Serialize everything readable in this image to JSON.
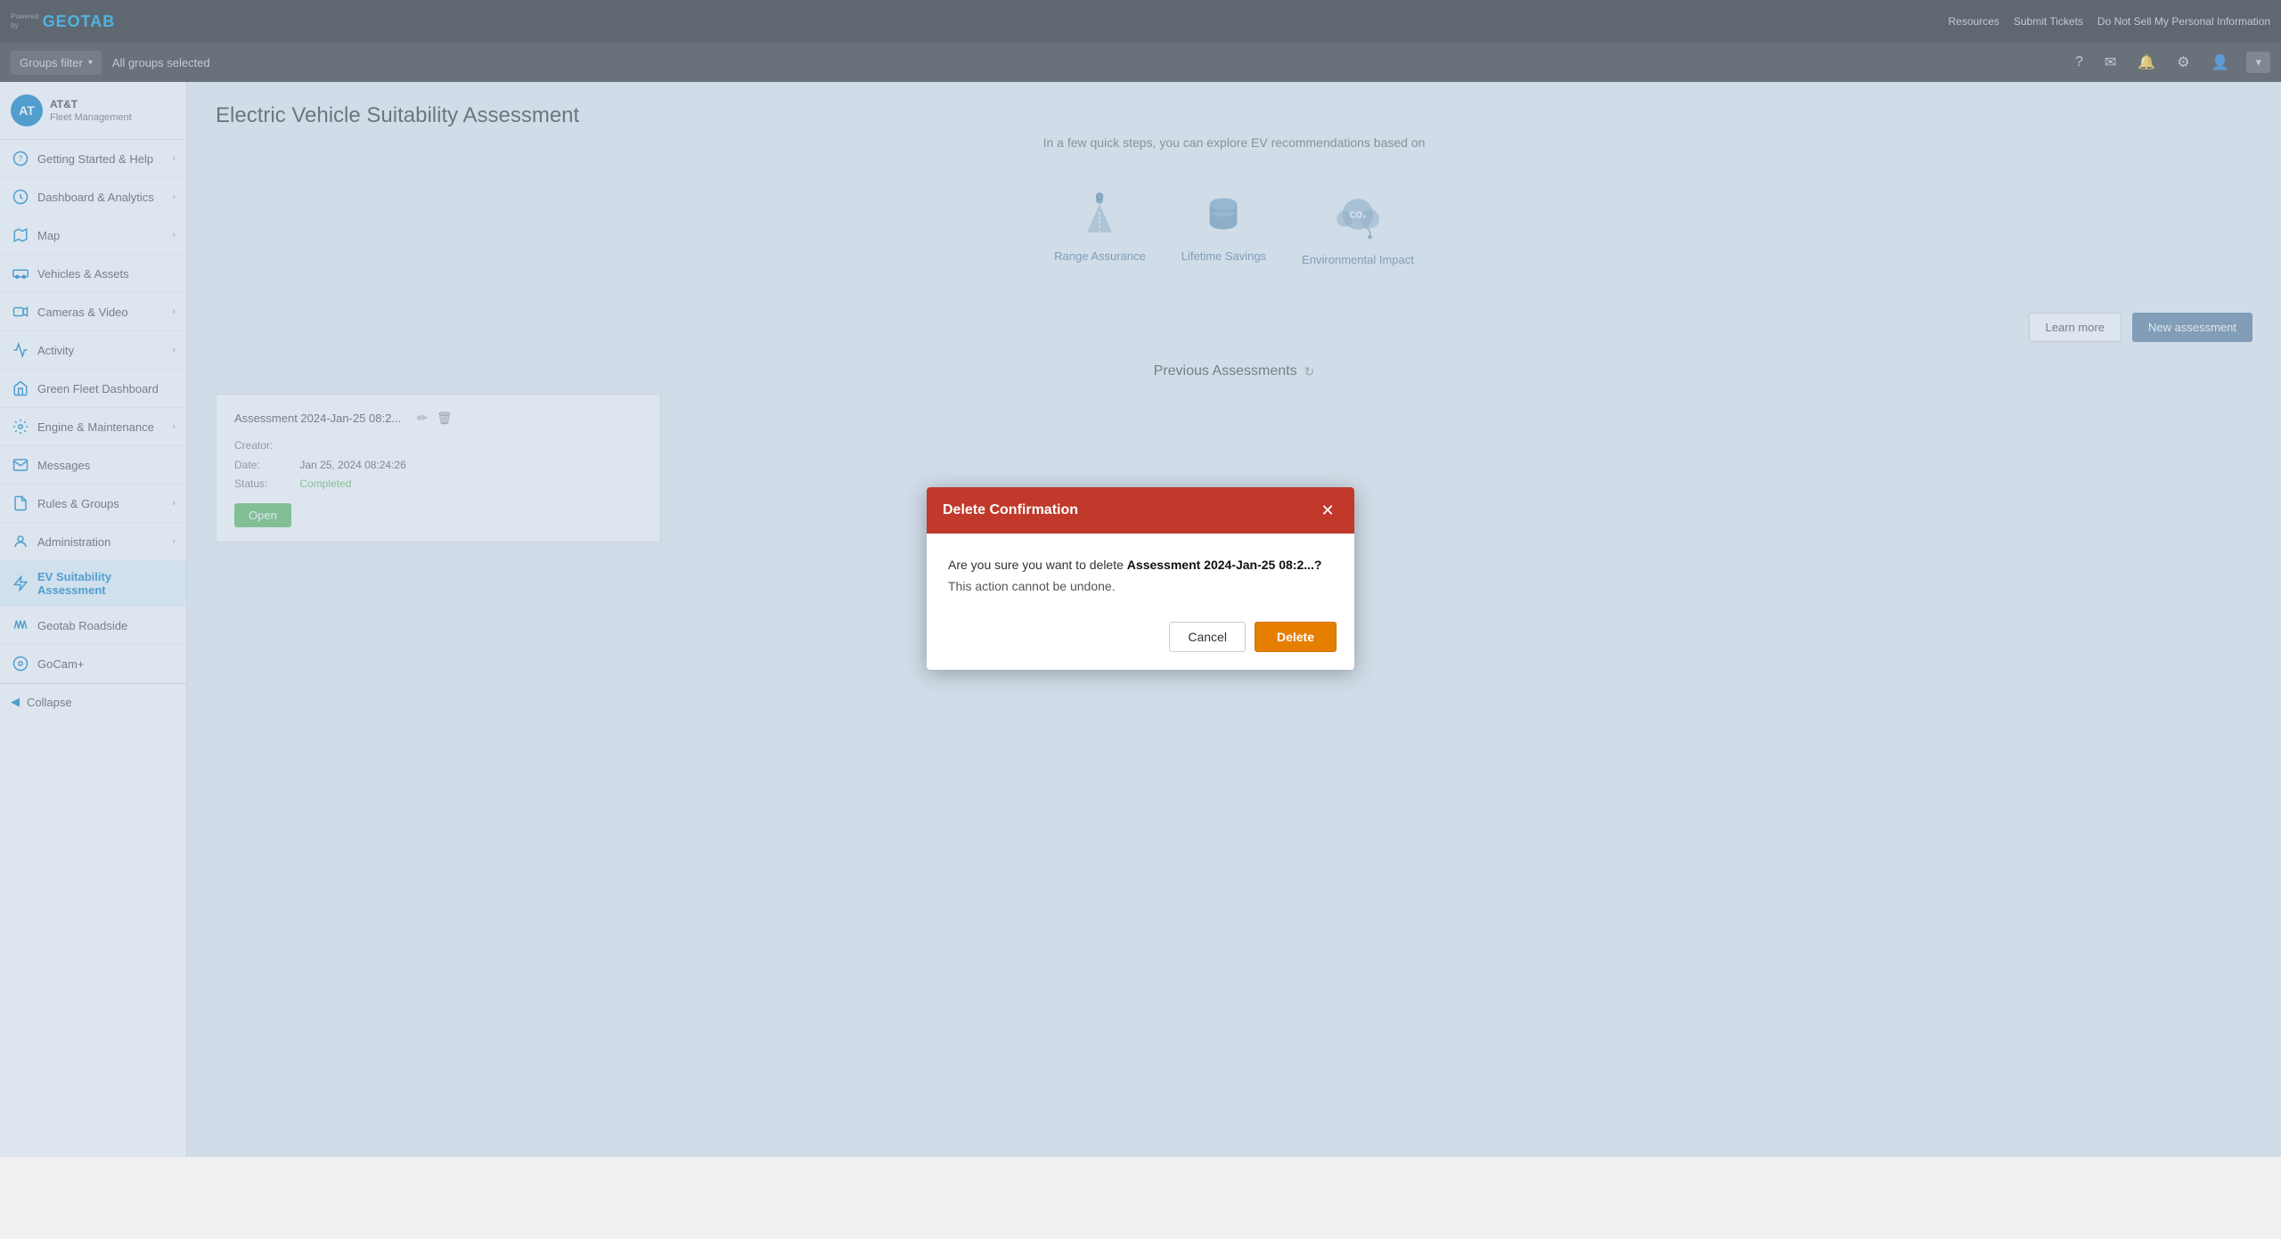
{
  "topbar": {
    "logo_powered": "Powered",
    "logo_by": "by",
    "logo_brand": "GEOTAB",
    "links": [
      "Resources",
      "Submit Tickets",
      "Do Not Sell My Personal Information"
    ]
  },
  "filterbar": {
    "groups_filter_label": "Groups filter",
    "groups_selected_label": "All groups selected",
    "chevron": "▾"
  },
  "sidebar": {
    "brand_name": "AT&T",
    "brand_sub": "Fleet Management",
    "items": [
      {
        "id": "getting-started",
        "label": "Getting Started & Help",
        "icon": "?"
      },
      {
        "id": "dashboard",
        "label": "Dashboard & Analytics",
        "icon": "📊"
      },
      {
        "id": "map",
        "label": "Map",
        "icon": "🗺"
      },
      {
        "id": "vehicles",
        "label": "Vehicles & Assets",
        "icon": "🚛"
      },
      {
        "id": "cameras",
        "label": "Cameras & Video",
        "icon": "📷"
      },
      {
        "id": "activity",
        "label": "Activity",
        "icon": "📈"
      },
      {
        "id": "green-fleet",
        "label": "Green Fleet Dashboard",
        "icon": "🌿"
      },
      {
        "id": "engine",
        "label": "Engine & Maintenance",
        "icon": "🔧"
      },
      {
        "id": "messages",
        "label": "Messages",
        "icon": "✉"
      },
      {
        "id": "rules",
        "label": "Rules & Groups",
        "icon": "📋"
      },
      {
        "id": "admin",
        "label": "Administration",
        "icon": "⚙"
      },
      {
        "id": "ev-assessment",
        "label": "EV Suitability Assessment",
        "icon": "⚡",
        "active": true
      },
      {
        "id": "roadside",
        "label": "Geotab Roadside",
        "icon": "🛣"
      },
      {
        "id": "gocam",
        "label": "GoCam+",
        "icon": "📹"
      }
    ],
    "collapse_label": "Collapse"
  },
  "main": {
    "title": "Electric Vehicle Suitability Assessment",
    "subtitle": "In a few quick steps, you can explore EV recommendations based on",
    "features": [
      {
        "id": "range",
        "label": "Range Assurance"
      },
      {
        "id": "savings",
        "label": "Lifetime Savings"
      },
      {
        "id": "impact",
        "label": "Environmental Impact"
      }
    ],
    "btn_learn_more": "Learn more",
    "btn_new_assessment": "New assessment",
    "previous_assessments_label": "Previous Assessments",
    "assessment": {
      "name": "Assessment 2024-Jan-25 08:2...",
      "creator_label": "Creator:",
      "creator_value": "",
      "date_label": "Date:",
      "date_value": "Jan 25, 2024 08:24:26",
      "status_label": "Status:",
      "status_value": "Completed",
      "btn_open": "Open"
    }
  },
  "modal": {
    "title": "Delete Confirmation",
    "message_prefix": "Are you sure you want to delete ",
    "assessment_name": "Assessment 2024-Jan-25 08:2...?",
    "warning": "This action cannot be undone.",
    "btn_cancel": "Cancel",
    "btn_delete": "Delete"
  }
}
